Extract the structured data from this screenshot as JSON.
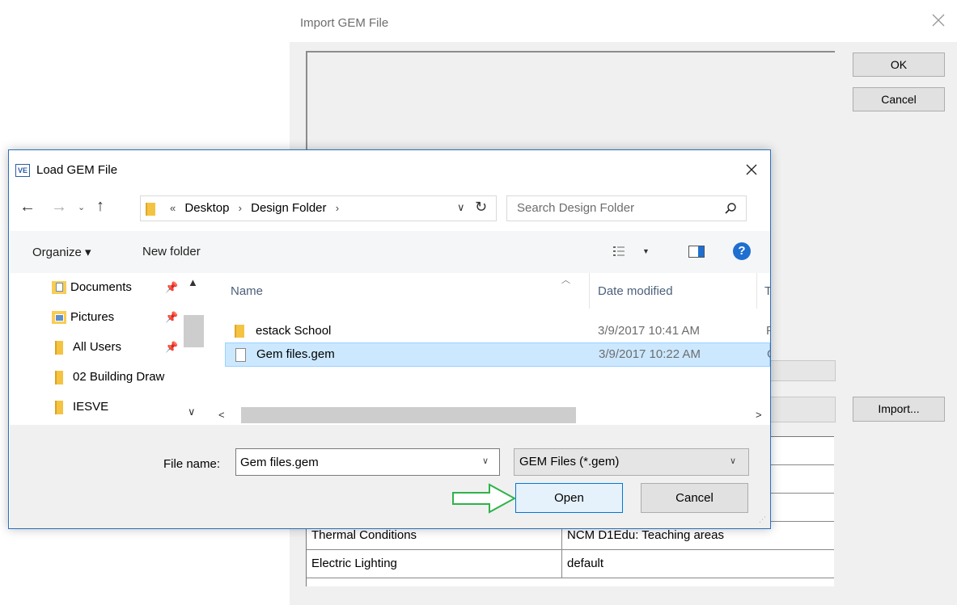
{
  "import_dialog": {
    "title": "Import GEM File",
    "ok_label": "OK",
    "cancel_label": "Cancel",
    "import_label": "Import...",
    "table_rows": [
      {
        "label": "Thermal Conditions",
        "value": "NCM D1Edu: Teaching areas"
      },
      {
        "label": "Electric Lighting",
        "value": "default"
      }
    ]
  },
  "load_dialog": {
    "app_icon_text": "VE",
    "title": "Load GEM File",
    "address": {
      "overflow": "«",
      "crumbs": [
        "Desktop",
        "Design Folder"
      ]
    },
    "search_placeholder": "Search Design Folder",
    "toolbar": {
      "organize_label": "Organize ▾",
      "new_folder_label": "New folder",
      "help_glyph": "?"
    },
    "nav_items": [
      {
        "label": "Documents",
        "icon": "documents-icon",
        "pinned": true
      },
      {
        "label": "Pictures",
        "icon": "pictures-icon",
        "pinned": true
      },
      {
        "label": "All Users",
        "icon": "folder-icon",
        "pinned": true
      },
      {
        "label": "02 Building Draw",
        "icon": "folder-icon",
        "pinned": false
      },
      {
        "label": "IESVE",
        "icon": "folder-icon",
        "pinned": false
      }
    ],
    "columns": {
      "name": "Name",
      "date": "Date modified",
      "type": "T"
    },
    "files": [
      {
        "name": "estack School",
        "date": "3/9/2017 10:41 AM",
        "type": "F",
        "icon": "folder-icon",
        "selected": false
      },
      {
        "name": "Gem files.gem",
        "date": "3/9/2017 10:22 AM",
        "type": "G",
        "icon": "file-icon",
        "selected": true
      }
    ],
    "file_name_label": "File name:",
    "file_name_value": "Gem files.gem",
    "filter_value": "GEM Files (*.gem)",
    "open_label": "Open",
    "cancel_label": "Cancel"
  },
  "colors": {
    "accent": "#0078d7",
    "selection": "#cce8ff",
    "annotation_arrow": "#2fb34a"
  }
}
